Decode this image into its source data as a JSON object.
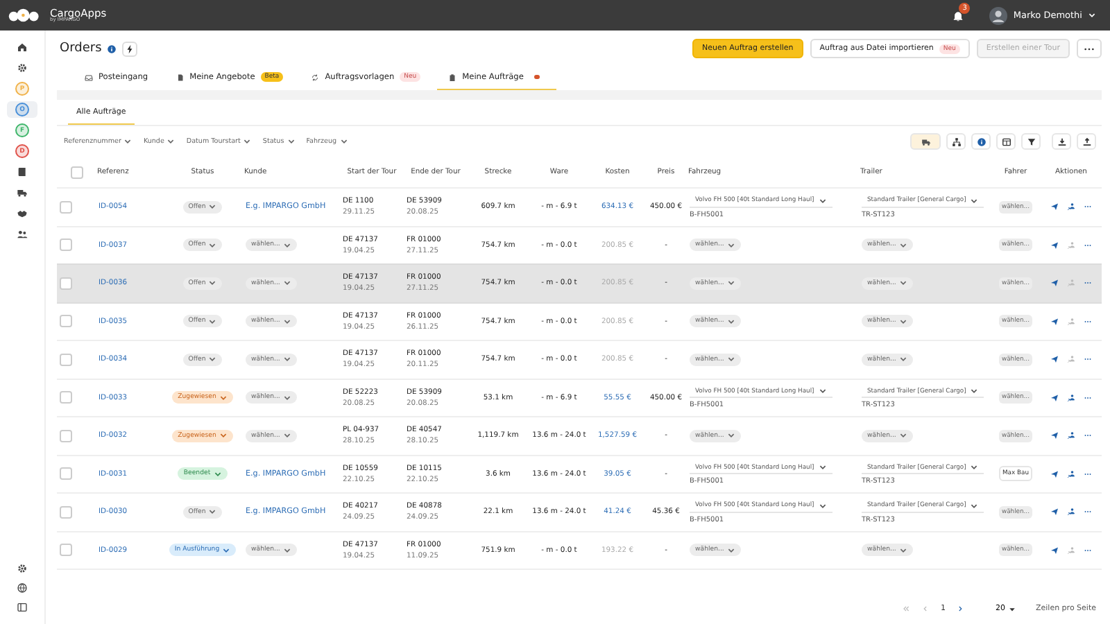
{
  "topbar": {
    "app_name": "CargoApps",
    "app_sub": "by IMPARGO",
    "notifications": "3",
    "user": "Marko Demothi"
  },
  "sidebar": {
    "items": [
      {
        "kind": "icon",
        "selected": false
      },
      {
        "kind": "icon",
        "selected": false
      },
      {
        "kind": "letter",
        "letter": "P",
        "color": "#f0b24a",
        "selected": false
      },
      {
        "kind": "letter",
        "letter": "O",
        "color": "#4a90d9",
        "selected": true
      },
      {
        "kind": "letter",
        "letter": "F",
        "color": "#3fb66b",
        "selected": false
      },
      {
        "kind": "letter",
        "letter": "D",
        "color": "#e0524a",
        "selected": false
      },
      {
        "kind": "icon",
        "selected": false
      },
      {
        "kind": "icon",
        "selected": false
      },
      {
        "kind": "icon",
        "selected": false
      },
      {
        "kind": "icon",
        "selected": false
      }
    ]
  },
  "header": {
    "title": "Orders",
    "buttons": [
      {
        "kind": "primary",
        "label": "Neuen Auftrag erstellen",
        "disabled": false
      },
      {
        "kind": "secondary",
        "label": "Auftrag aus Datei importieren",
        "badge": "Neu",
        "disabled": false
      },
      {
        "kind": "secondary",
        "label": "Erstellen einer Tour",
        "disabled": true
      }
    ]
  },
  "tabs": [
    {
      "label": "Posteingang",
      "dot": false,
      "selected": false
    },
    {
      "label": "Meine Angebote",
      "badge": "Beta",
      "dot": false,
      "selected": false
    },
    {
      "label": "Auftragsvorlagen",
      "badge": "Neu",
      "dot": false,
      "selected": false
    },
    {
      "label": "Meine Aufträge",
      "dot": true,
      "selected": true
    }
  ],
  "subtabs": [
    {
      "label": "Alle Aufträge",
      "selected": true
    }
  ],
  "filters": [
    "Referenznummer",
    "Kunde",
    "Datum Tourstart",
    "Status",
    "Fahrzeug"
  ],
  "toolbar": [
    {
      "selected": true
    },
    {
      "selected": false
    },
    {
      "selected": false
    },
    {
      "selected": false
    },
    {
      "selected": false
    },
    {
      "selected": false
    },
    {
      "selected": false
    }
  ],
  "table": {
    "select_all_checked": false,
    "columns": [
      "Referenz",
      "Status",
      "Kunde",
      "Start der Tour",
      "Ende der Tour",
      "Strecke",
      "Ware",
      "Kosten",
      "Preis",
      "Fahrzeug",
      "Trailer",
      "Fahrer",
      "Aktionen"
    ],
    "rows": [
      {
        "checked": false,
        "hovered": false,
        "ref": "ID-0054",
        "status": {
          "label": "Offen",
          "kind": "open"
        },
        "customer": {
          "kind": "link",
          "text": "E.g. IMPARGO GmbH"
        },
        "start": [
          "DE 1100",
          "29.11.25"
        ],
        "end": [
          "DE 53909",
          "20.08.25"
        ],
        "distance": "609.7 km",
        "goods": "- m - 6.9 t",
        "cost": {
          "text": "634.13 €",
          "kind": "calculated"
        },
        "price": "450.00 €",
        "vehicle": {
          "kind": "assigned",
          "name": "Volvo FH 500 [40t Standard Long Haul]",
          "plate": "B-FH5001"
        },
        "trailer": {
          "kind": "assigned",
          "name": "Standard Trailer [General Cargo]",
          "plate": "TR-ST123"
        },
        "driver": {
          "kind": "select",
          "text": "wählen..."
        },
        "assign_enabled": true
      },
      {
        "checked": false,
        "hovered": false,
        "ref": "ID-0037",
        "status": {
          "label": "Offen",
          "kind": "open"
        },
        "customer": {
          "kind": "select",
          "text": "wählen..."
        },
        "start": [
          "DE 47137",
          "19.04.25"
        ],
        "end": [
          "FR 01000",
          "27.11.25"
        ],
        "distance": "754.7 km",
        "goods": "- m - 0.0 t",
        "cost": {
          "text": "200.85 €",
          "kind": "estimate"
        },
        "price": "-",
        "vehicle": {
          "kind": "select",
          "text": "wählen..."
        },
        "trailer": {
          "kind": "select",
          "text": "wählen..."
        },
        "driver": {
          "kind": "select",
          "text": "wählen..."
        },
        "assign_enabled": false
      },
      {
        "checked": false,
        "hovered": true,
        "ref": "ID-0036",
        "status": {
          "label": "Offen",
          "kind": "open"
        },
        "customer": {
          "kind": "select",
          "text": "wählen..."
        },
        "start": [
          "DE 47137",
          "19.04.25"
        ],
        "end": [
          "FR 01000",
          "27.11.25"
        ],
        "distance": "754.7 km",
        "goods": "- m - 0.0 t",
        "cost": {
          "text": "200.85 €",
          "kind": "estimate"
        },
        "price": "-",
        "vehicle": {
          "kind": "select",
          "text": "wählen..."
        },
        "trailer": {
          "kind": "select",
          "text": "wählen..."
        },
        "driver": {
          "kind": "select",
          "text": "wählen..."
        },
        "assign_enabled": false
      },
      {
        "checked": false,
        "hovered": false,
        "ref": "ID-0035",
        "status": {
          "label": "Offen",
          "kind": "open"
        },
        "customer": {
          "kind": "select",
          "text": "wählen..."
        },
        "start": [
          "DE 47137",
          "19.04.25"
        ],
        "end": [
          "FR 01000",
          "26.11.25"
        ],
        "distance": "754.7 km",
        "goods": "- m - 0.0 t",
        "cost": {
          "text": "200.85 €",
          "kind": "estimate"
        },
        "price": "-",
        "vehicle": {
          "kind": "select",
          "text": "wählen..."
        },
        "trailer": {
          "kind": "select",
          "text": "wählen..."
        },
        "driver": {
          "kind": "select",
          "text": "wählen..."
        },
        "assign_enabled": false
      },
      {
        "checked": false,
        "hovered": false,
        "ref": "ID-0034",
        "status": {
          "label": "Offen",
          "kind": "open"
        },
        "customer": {
          "kind": "select",
          "text": "wählen..."
        },
        "start": [
          "DE 47137",
          "19.04.25"
        ],
        "end": [
          "FR 01000",
          "20.11.25"
        ],
        "distance": "754.7 km",
        "goods": "- m - 0.0 t",
        "cost": {
          "text": "200.85 €",
          "kind": "estimate"
        },
        "price": "-",
        "vehicle": {
          "kind": "select",
          "text": "wählen..."
        },
        "trailer": {
          "kind": "select",
          "text": "wählen..."
        },
        "driver": {
          "kind": "select",
          "text": "wählen..."
        },
        "assign_enabled": false
      },
      {
        "checked": false,
        "hovered": false,
        "ref": "ID-0033",
        "status": {
          "label": "Zugewiesen",
          "kind": "assigned"
        },
        "customer": {
          "kind": "select",
          "text": "wählen..."
        },
        "start": [
          "DE 52223",
          "20.08.25"
        ],
        "end": [
          "DE 53909",
          "20.08.25"
        ],
        "distance": "53.1 km",
        "goods": "- m - 6.9 t",
        "cost": {
          "text": "55.55 €",
          "kind": "calculated"
        },
        "price": "450.00 €",
        "vehicle": {
          "kind": "assigned",
          "name": "Volvo FH 500 [40t Standard Long Haul]",
          "plate": "B-FH5001"
        },
        "trailer": {
          "kind": "assigned",
          "name": "Standard Trailer [General Cargo]",
          "plate": "TR-ST123"
        },
        "driver": {
          "kind": "select",
          "text": "wählen..."
        },
        "assign_enabled": true
      },
      {
        "checked": false,
        "hovered": false,
        "ref": "ID-0032",
        "status": {
          "label": "Zugewiesen",
          "kind": "assigned"
        },
        "customer": {
          "kind": "select",
          "text": "wählen..."
        },
        "start": [
          "PL 04-937",
          "28.10.25"
        ],
        "end": [
          "DE 40547",
          "28.10.25"
        ],
        "distance": "1,119.7 km",
        "goods": "13.6 m - 24.0 t",
        "cost": {
          "text": "1,527.59 €",
          "kind": "calculated"
        },
        "price": "-",
        "vehicle": {
          "kind": "select",
          "text": "wählen..."
        },
        "trailer": {
          "kind": "select",
          "text": "wählen..."
        },
        "driver": {
          "kind": "select",
          "text": "wählen..."
        },
        "assign_enabled": true
      },
      {
        "checked": false,
        "hovered": false,
        "ref": "ID-0031",
        "status": {
          "label": "Beendet",
          "kind": "done"
        },
        "customer": {
          "kind": "link",
          "text": "E.g. IMPARGO GmbH"
        },
        "start": [
          "DE 10559",
          "22.10.25"
        ],
        "end": [
          "DE 10115",
          "22.10.25"
        ],
        "distance": "3.6 km",
        "goods": "13.6 m - 24.0 t",
        "cost": {
          "text": "39.05 €",
          "kind": "calculated"
        },
        "price": "-",
        "vehicle": {
          "kind": "assigned",
          "name": "Volvo FH 500 [40t Standard Long Haul]",
          "plate": "B-FH5001"
        },
        "trailer": {
          "kind": "assigned",
          "name": "Standard Trailer [General Cargo]",
          "plate": "TR-ST123"
        },
        "driver": {
          "kind": "assigned",
          "text": "Max Bau"
        },
        "assign_enabled": true
      },
      {
        "checked": false,
        "hovered": false,
        "ref": "ID-0030",
        "status": {
          "label": "Offen",
          "kind": "open"
        },
        "customer": {
          "kind": "link",
          "text": "E.g. IMPARGO GmbH"
        },
        "start": [
          "DE 40217",
          "24.09.25"
        ],
        "end": [
          "DE 40878",
          "24.09.25"
        ],
        "distance": "22.1 km",
        "goods": "13.6 m - 24.0 t",
        "cost": {
          "text": "41.24 €",
          "kind": "calculated"
        },
        "price": "45.36 €",
        "vehicle": {
          "kind": "assigned",
          "name": "Volvo FH 500 [40t Standard Long Haul]",
          "plate": "B-FH5001"
        },
        "trailer": {
          "kind": "assigned",
          "name": "Standard Trailer [General Cargo]",
          "plate": "TR-ST123"
        },
        "driver": {
          "kind": "select",
          "text": "wählen..."
        },
        "assign_enabled": true
      },
      {
        "checked": false,
        "hovered": false,
        "ref": "ID-0029",
        "status": {
          "label": "In Ausführung",
          "kind": "running"
        },
        "customer": {
          "kind": "select",
          "text": "wählen..."
        },
        "start": [
          "DE 47137",
          "19.04.25"
        ],
        "end": [
          "FR 01000",
          "11.09.25"
        ],
        "distance": "751.9 km",
        "goods": "- m - 0.0 t",
        "cost": {
          "text": "193.22 €",
          "kind": "estimate"
        },
        "price": "-",
        "vehicle": {
          "kind": "select",
          "text": "wählen..."
        },
        "trailer": {
          "kind": "select",
          "text": "wählen..."
        },
        "driver": {
          "kind": "select",
          "text": "wählen..."
        },
        "assign_enabled": false
      }
    ]
  },
  "pagination": {
    "first_disabled": true,
    "prev_disabled": true,
    "page": "1",
    "next_disabled": false,
    "per_page": "20",
    "per_page_label": "Zeilen pro Seite"
  }
}
